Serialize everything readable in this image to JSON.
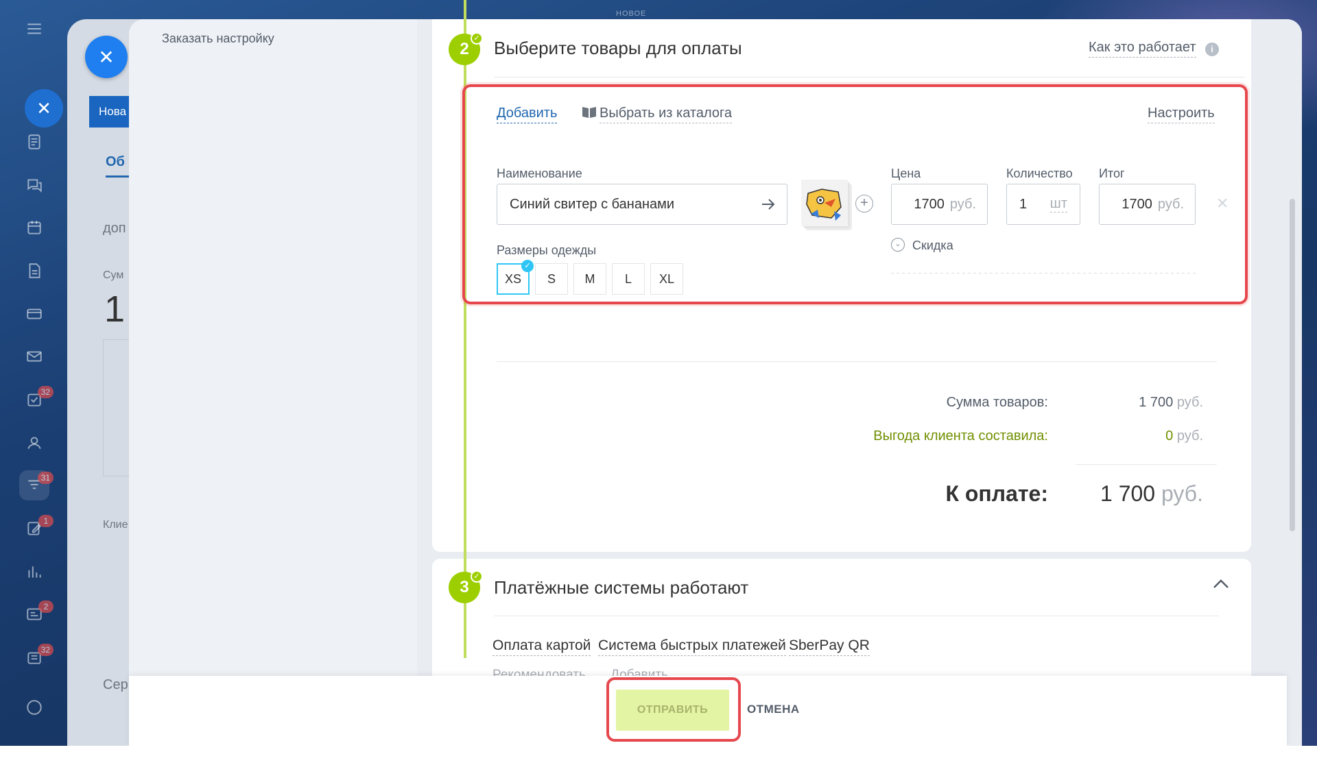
{
  "top_label": "НОВОЕ",
  "rail": {
    "badges": [
      "32",
      "31",
      "1",
      "2",
      "32"
    ]
  },
  "background": {
    "tag": "Нова",
    "tab": "Об",
    "text1": "доп",
    "text2": "Сум",
    "big": "1",
    "text3": "Клие",
    "text4": "Сер"
  },
  "sidebar": {
    "order_setup": "Заказать настройку"
  },
  "step2": {
    "number": "2",
    "title": "Выберите товары для оплаты",
    "how_it_works": "Как это работает",
    "add_link": "Добавить",
    "catalog_link": "Выбрать из каталога",
    "configure_link": "Настроить",
    "name_label": "Наименование",
    "name_value": "Синий свитер с бананами",
    "price_label": "Цена",
    "price_value": "1700",
    "price_unit": "руб.",
    "qty_label": "Количество",
    "qty_value": "1",
    "qty_unit": "шт",
    "total_label": "Итог",
    "total_value": "1700",
    "total_unit": "руб.",
    "discount_label": "Скидка",
    "sizes_label": "Размеры одежды",
    "sizes": [
      "XS",
      "S",
      "M",
      "L",
      "XL"
    ],
    "selected_size": "XS",
    "summary": {
      "goods_sum_label": "Сумма товаров:",
      "goods_sum_value": "1 700",
      "goods_sum_unit": "руб.",
      "benefit_label": "Выгода клиента составила:",
      "benefit_value": "0",
      "benefit_unit": "руб.",
      "to_pay_label": "К оплате:",
      "to_pay_value": "1 700",
      "to_pay_unit": "руб."
    }
  },
  "step3": {
    "number": "3",
    "title": "Платёжные системы работают",
    "methods": [
      "Оплата картой",
      "Система быстрых платежей",
      "SberPay QR"
    ],
    "recommend": "Рекомендовать",
    "add": "Добавить"
  },
  "footer": {
    "send_label": "ОТПРАВИТЬ",
    "cancel_label": "ОТМЕНА"
  },
  "colors": {
    "accent_green": "#9dcf00",
    "highlight_red": "#e6474d",
    "link_blue": "#2067b0",
    "benefit_green": "#6f8f00"
  }
}
